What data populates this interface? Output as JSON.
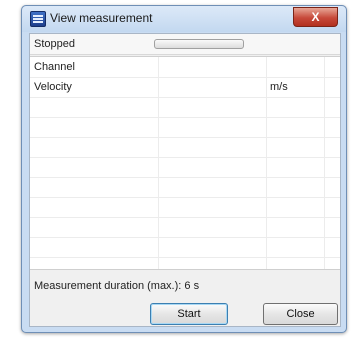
{
  "window": {
    "title": "View measurement",
    "close_label": "X"
  },
  "status": {
    "text": "Stopped",
    "progress": 0
  },
  "table": {
    "columns": [
      "Channel",
      "",
      ""
    ],
    "rows": [
      [
        "Velocity",
        "",
        "m/s"
      ]
    ]
  },
  "footer": {
    "duration_text": "Measurement duration (max.): 6 s",
    "start_label": "Start",
    "close_label": "Close"
  }
}
